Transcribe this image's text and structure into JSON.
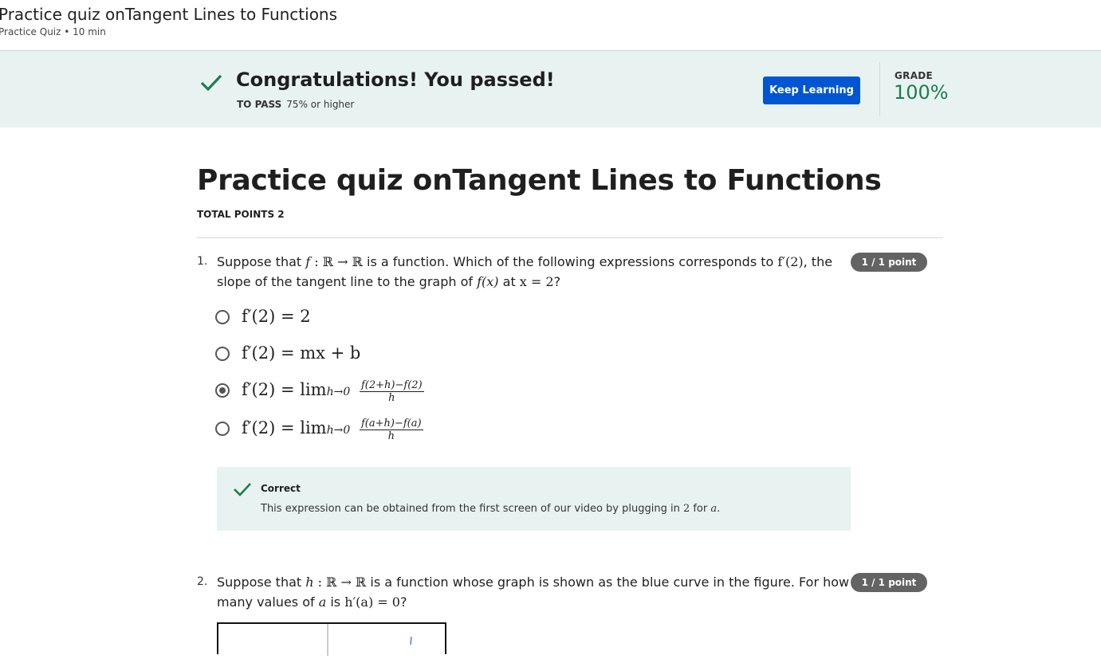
{
  "topbar": {
    "title": "Practice quiz onTangent Lines to Functions",
    "subtitle": "Practice Quiz • 10 min"
  },
  "banner": {
    "message": "Congratulations! You passed!",
    "to_pass_label": "TO PASS",
    "to_pass_value": "75% or higher",
    "keep_learning": "Keep Learning",
    "grade_label": "GRADE",
    "grade_value": "100%",
    "accent": "#0056d2",
    "success": "#1d7c50"
  },
  "quiz": {
    "title": "Practice quiz onTangent Lines to Functions",
    "total_points": "TOTAL POINTS 2"
  },
  "questions": [
    {
      "number": "1.",
      "badge": "1 / 1 point",
      "text_a": "Suppose that ",
      "m1": "f",
      "m2": " : ℝ → ℝ",
      "text_b": " is a function. Which of the following expressions corresponds to ",
      "m3": "f′(2)",
      "text_c": ", the slope of the tangent line to the graph of ",
      "m4": "f(x)",
      "text_d": " at ",
      "m5": "x = 2",
      "text_e": "?",
      "options": [
        {
          "expr": "f′(2) = 2"
        },
        {
          "expr": "f′(2) = mx + b"
        },
        {
          "expr_prefix": "f′(2) = lim",
          "sub": "h→0",
          "num": "f(2+h)−f(2)",
          "den": "h"
        },
        {
          "expr_prefix": "f′(2) = lim",
          "sub": "h→0",
          "num": "f(a+h)−f(a)",
          "den": "h"
        }
      ],
      "selected": 2,
      "feedback": {
        "title": "Correct",
        "text_a": "This expression can be obtained from the first screen of our video by plugging in ",
        "m_two": "2",
        "text_b": " for ",
        "m_a": "a",
        "text_c": "."
      }
    },
    {
      "number": "2.",
      "badge": "1 / 1 point",
      "text_a": "Suppose that ",
      "m1": "h",
      "m2": " : ℝ → ℝ",
      "text_b": " is a function whose graph is shown as the blue curve in the figure. For how many values of ",
      "m3": "a",
      "text_c": " is ",
      "m4": "h′(a) = 0",
      "text_d": "?"
    }
  ]
}
